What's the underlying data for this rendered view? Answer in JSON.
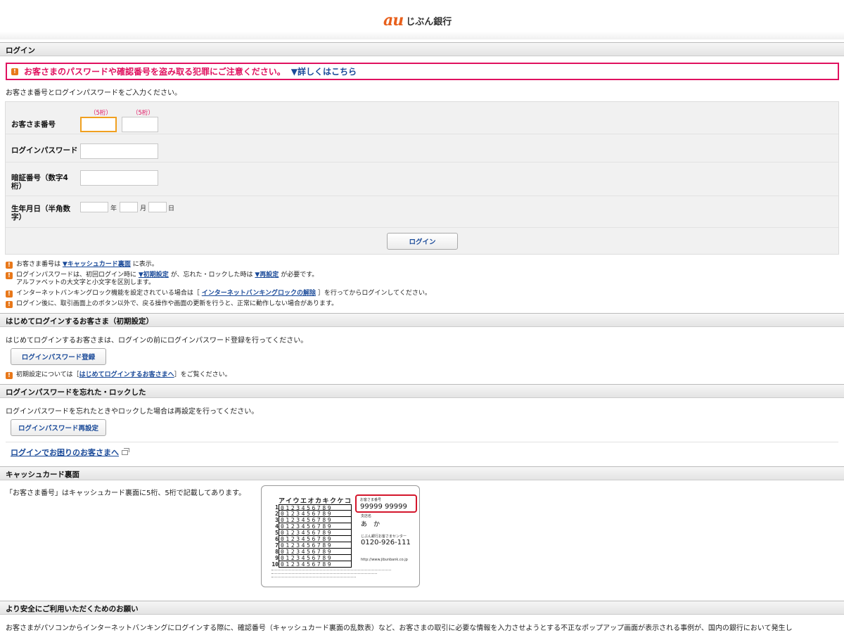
{
  "header": {
    "logo_mark": "au",
    "logo_text": "じぶん銀行"
  },
  "login": {
    "section_title": "ログイン",
    "alert_text": "お客さまのパスワードや確認番号を盗み取る犯罪にご注意ください。",
    "alert_link": "▼詳しくはこちら",
    "intro": "お客さま番号とログインパスワードをご入力ください。",
    "customer_number_label": "お客さま番号",
    "digits_hint_1": "（5桁）",
    "digits_hint_2": "（5桁）",
    "password_label": "ログインパスワード",
    "pin_label": "暗証番号（数字4桁）",
    "birthdate_label": "生年月日（半角数字）",
    "year_unit": "年",
    "month_unit": "月",
    "day_unit": "日",
    "login_button": "ログイン",
    "notes": {
      "n1_pre": "お客さま番号は",
      "n1_link": "▼キャッシュカード裏面",
      "n1_post": "に表示。",
      "n2_pre": "ログインパスワードは、初回ログイン時に",
      "n2_link1": "▼初期設定",
      "n2_mid": "が、忘れた・ロックした時は",
      "n2_link2": "▼再設定",
      "n2_post": "が必要です。",
      "n2_line2": "アルファベットの大文字と小文字を区別します。",
      "n3_pre": "インターネットバンキングロック機能を設定されている場合は［",
      "n3_link": "インターネットバンキングロックの解除",
      "n3_post": "］を行ってからログインしてください。",
      "n4": "ログイン後に、取引画面上のボタン以外で、戻る操作や画面の更新を行うと、正常に動作しない場合があります。"
    }
  },
  "first_login": {
    "section_title": "はじめてログインするお客さま（初期設定）",
    "text": "はじめてログインするお客さまは、ログインの前にログインパスワード登録を行ってください。",
    "button": "ログインパスワード登録",
    "note_pre": "初期設定については［",
    "note_link": "はじめてログインするお客さまへ",
    "note_post": "］をご覧ください。"
  },
  "forgot": {
    "section_title": "ログインパスワードを忘れた・ロックした",
    "text": "ログインパスワードを忘れたときやロックした場合は再設定を行ってください。",
    "button": "ログインパスワード再設定",
    "trouble_link": "ログインでお困りのお客さまへ"
  },
  "cash_card": {
    "section_title": "キャッシュカード裏面",
    "text": "「お客さま番号」はキャッシュカード裏面に5桁、5桁で記載してあります。",
    "card": {
      "kana_header": "アイウエオカキクケコ",
      "row_numbers": [
        "1",
        "2",
        "3",
        "4",
        "5",
        "6",
        "7",
        "8",
        "9",
        "10"
      ],
      "row_digits": "0123456789",
      "customer_number_caption": "お客さま番号",
      "customer_number": "99999 99999",
      "branch_caption": "支店名",
      "branch_name": "あ　か",
      "center_caption": "じぶん銀行お客さまセンター",
      "phone": "0120-926-111",
      "site": "http://www.jibunbank.co.jp"
    }
  },
  "safety": {
    "section_title": "より安全にご利用いただくためのお願い",
    "text": "お客さまがパソコンからインターネットバンキングにログインする際に、確認番号（キャッシュカード裏面の乱数表）など、お客さまの取引に必要な情報を入力させようとする不正なポップアップ画面が表示される事例が、国内の銀行において発生し"
  },
  "colors": {
    "accent": "#e0115f",
    "link": "#1a4a99",
    "warning": "#e8781a",
    "brand": "#e8601c"
  }
}
